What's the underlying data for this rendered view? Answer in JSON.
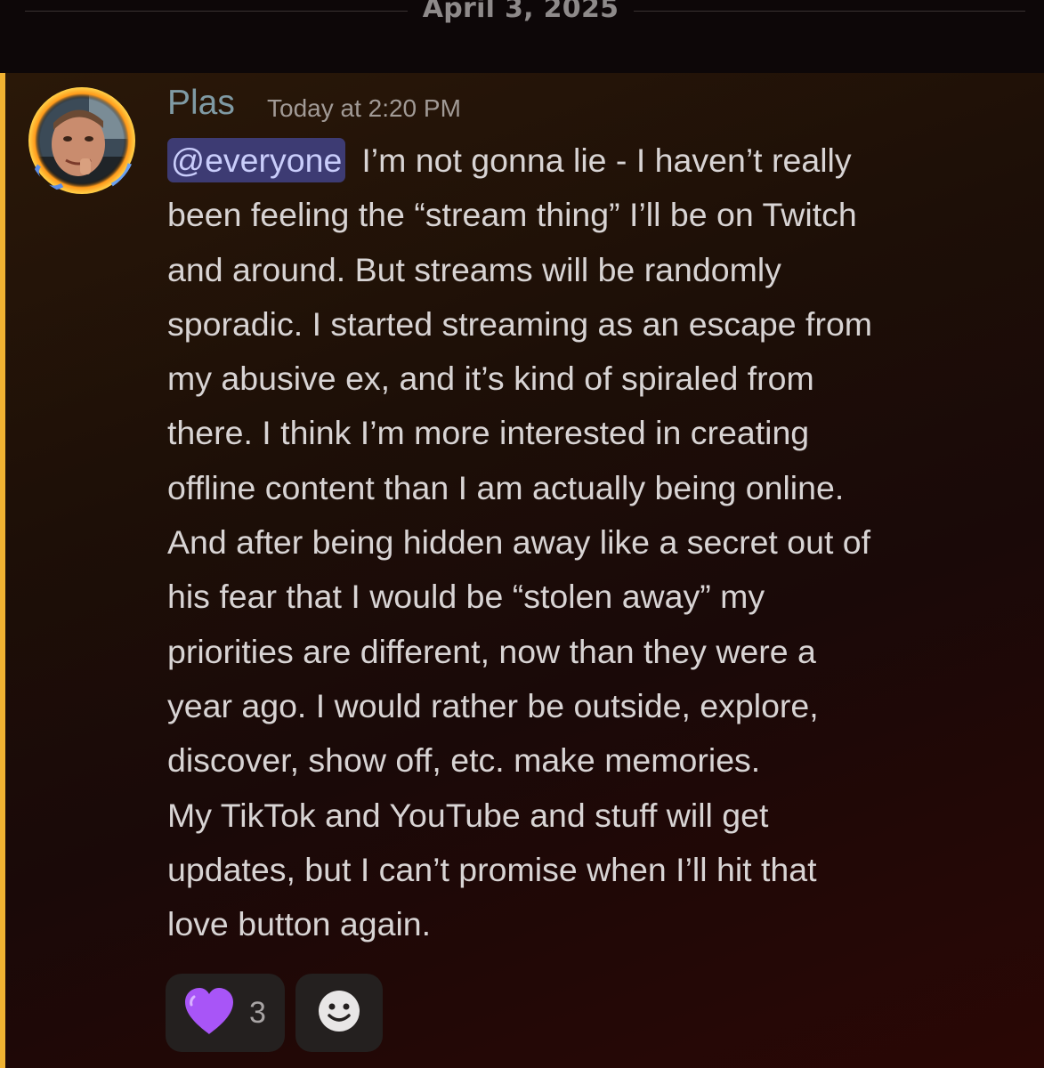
{
  "divider": {
    "date": "April 3, 2025"
  },
  "message": {
    "author": "Plas",
    "timestamp": "Today at 2:20 PM",
    "mention": "@everyone",
    "text": "I’m not gonna lie - I haven’t really\nbeen feeling the “stream thing” I’ll be on Twitch\nand around. But streams will be randomly\nsporadic. I started streaming as an escape from\nmy abusive ex, and it’s kind of spiraled from\nthere. I think I’m more interested in creating\noffline content than I am actually being online.\nAnd after being hidden away like a secret out of\nhis fear that I would  be “stolen away” my\npriorities are different, now than they were a\nyear ago. I would rather be outside, explore,\ndiscover, show off, etc. make memories.\nMy TikTok and YouTube and stuff will get\nupdates, but I can’t promise when I’ll hit that\nlove button again.",
    "reactions": [
      {
        "emoji": "purple-heart-icon",
        "count": "3"
      }
    ],
    "add_reaction_icon": "smiley-add-reaction-icon"
  },
  "colors": {
    "mention_bar": "#f0b232",
    "mention_pill_bg": "#3d3b73",
    "mention_pill_text": "#c9cdfb",
    "author": "#7f9aa4",
    "heart": "#a855f7"
  }
}
